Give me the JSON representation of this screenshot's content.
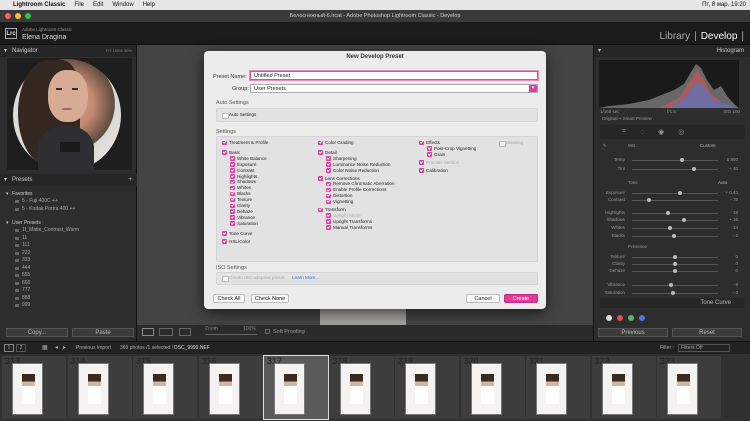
{
  "menubar": {
    "app": "Lightroom Classic",
    "items": [
      "File",
      "Edit",
      "Window",
      "Help"
    ],
    "clock": "Пт, 8 мар. 19:20"
  },
  "window_title": "Белоснежный-6.lrcat - Adobe Photoshop Lightroom Classic - Develop",
  "identity": {
    "logo": "Lrc",
    "product": "Adobe Lightroom Classic",
    "user": "Elena Dragina"
  },
  "modules": [
    "Library",
    "|",
    "Develop",
    "|"
  ],
  "left_panel": {
    "navigator": "Navigator",
    "nav_zoom": [
      "FIT",
      "100%",
      "50%"
    ],
    "presets": "Presets",
    "favorites_group": "Favorites",
    "favorites": [
      "5 - Fuji 400C ++",
      "5 - Kodak Portra 400 ++"
    ],
    "user_group": "User Presets",
    "user_presets": [
      "1f_Matte_Contrast_Warm",
      "11",
      "111",
      "222",
      "333",
      "444",
      "555",
      "666",
      "777",
      "888",
      "999"
    ],
    "copy": "Copy...",
    "paste": "Paste"
  },
  "toolbar": {
    "zoom": "Zoom",
    "zoom_val": "100%",
    "soft_proofing": "Soft Proofing"
  },
  "right_panel": {
    "histogram": "Histogram",
    "hist_info": [
      "Original + Smart Preview",
      "1/160 sec",
      "f/1.8",
      "ISO 100"
    ],
    "wb_label": "WB :",
    "wb_value": "Custom",
    "tone_label": "Tone",
    "tone_auto": "Auto",
    "presence_label": "Presence",
    "sliders": [
      {
        "label": "Temp",
        "value": "5 800",
        "pos": 0.58
      },
      {
        "label": "Tint",
        "value": "+ 40",
        "pos": 0.72
      },
      {
        "label": "Exposure",
        "value": "+ 0,43",
        "pos": 0.56
      },
      {
        "label": "Contrast",
        "value": "- 75",
        "pos": 0.2
      },
      {
        "label": "Highlights",
        "value": "- 18",
        "pos": 0.42
      },
      {
        "label": "Shadows",
        "value": "+ 16",
        "pos": 0.6
      },
      {
        "label": "Whites",
        "value": "- 14",
        "pos": 0.44
      },
      {
        "label": "Blacks",
        "value": "- 2",
        "pos": 0.49
      },
      {
        "label": "Texture",
        "value": "0",
        "pos": 0.5
      },
      {
        "label": "Clarity",
        "value": "0",
        "pos": 0.5
      },
      {
        "label": "Dehaze",
        "value": "0",
        "pos": 0.5
      },
      {
        "label": "Vibrance",
        "value": "- 9",
        "pos": 0.45
      },
      {
        "label": "Saturation",
        "value": "- 3",
        "pos": 0.48
      }
    ],
    "tone_curve": "Tone Curve",
    "previous": "Previous",
    "reset": "Reset"
  },
  "bottom_bar": {
    "pages": [
      "1",
      "2"
    ],
    "previous_import": "Previous Import",
    "count": "369 photos /1 selected /",
    "filename": "DSC_9999.NEF",
    "filter_label": "Filter :",
    "filter_value": "Filters Off"
  },
  "filmstrip": [
    "313",
    "314",
    "315",
    "316",
    "317",
    "318",
    "319",
    "320",
    "321",
    "322",
    "323"
  ],
  "dialog": {
    "title": "New Develop Preset",
    "name_label": "Preset Name:",
    "name_value": "Untitled Preset",
    "group_label": "Group:",
    "group_value": "User Presets",
    "auto_settings_header": "Auto Settings",
    "auto_settings": "Auto Settings",
    "settings_header": "Settings",
    "col1": [
      "Treatment & Profile",
      "Basic",
      "White Balance",
      "Exposure",
      "Contrast",
      "Highlights",
      "Shadows",
      "Whites",
      "Blacks",
      "Texture",
      "Clarity",
      "Dehaze",
      "Vibrance",
      "Saturation",
      "Tone Curve",
      "HSL/Color"
    ],
    "col2": [
      "Color Grading",
      "Detail",
      "Sharpening",
      "Luminance Noise Reduction",
      "Color Noise Reduction",
      "Lens Corrections",
      "Remove Chromatic Aberration",
      "Enable Profile Corrections",
      "Distortion",
      "Vignetting",
      "Transform",
      "Upright Mode",
      "Upright Transforms",
      "Manual Transforms"
    ],
    "col3": [
      "Effects",
      "Post-Crop Vignetting",
      "Grain",
      "Process Version",
      "Calibration",
      "Masking"
    ],
    "iso_header": "ISO Settings",
    "iso_check": "Create ISO adaptive preset",
    "learn_more": "Learn More...",
    "check_all": "Check All",
    "check_none": "Check None",
    "cancel": "Cancel",
    "create": "Create"
  },
  "colors": {
    "accent": "#e0399a",
    "bg": "#2a2a2a",
    "dialog": "#ececec"
  }
}
